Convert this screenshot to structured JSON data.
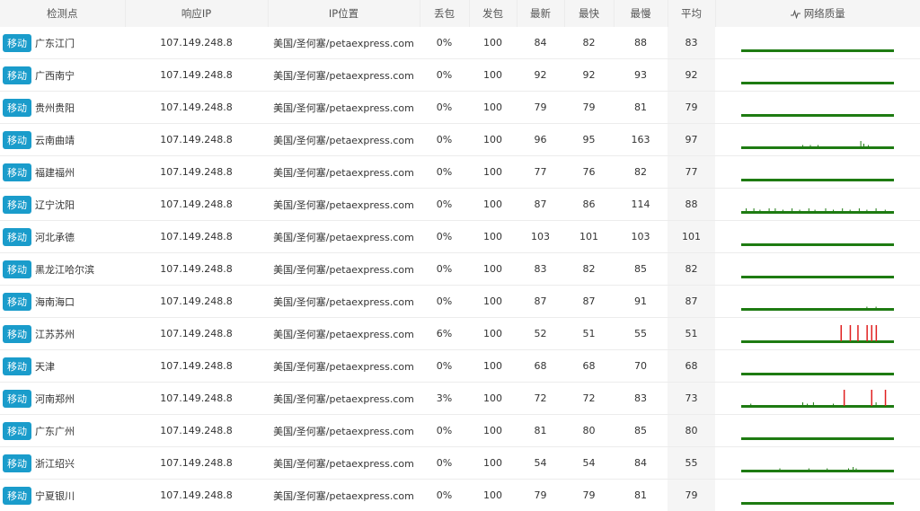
{
  "headers": {
    "node": "检测点",
    "ip": "响应IP",
    "location": "IP位置",
    "loss": "丢包",
    "sent": "发包",
    "latest": "最新",
    "fastest": "最快",
    "slowest": "最慢",
    "average": "平均",
    "quality": "网络质量"
  },
  "colors": {
    "good": "#1e7b12",
    "loss": "#e02020",
    "badge": "#1a9ccb"
  },
  "icons": {
    "quality": "pulse-icon"
  },
  "rows": [
    {
      "isp": "移动",
      "node": "广东江门",
      "ip": "107.149.248.8",
      "location": "美国/圣何塞/petaexpress.com",
      "loss": "0%",
      "sent": "100",
      "latest": "84",
      "fastest": "82",
      "slowest": "88",
      "average": "83",
      "quality": {
        "spikes": [],
        "lossMarks": []
      }
    },
    {
      "isp": "移动",
      "node": "广西南宁",
      "ip": "107.149.248.8",
      "location": "美国/圣何塞/petaexpress.com",
      "loss": "0%",
      "sent": "100",
      "latest": "92",
      "fastest": "92",
      "slowest": "93",
      "average": "92",
      "quality": {
        "spikes": [],
        "lossMarks": []
      }
    },
    {
      "isp": "移动",
      "node": "贵州贵阳",
      "ip": "107.149.248.8",
      "location": "美国/圣何塞/petaexpress.com",
      "loss": "0%",
      "sent": "100",
      "latest": "79",
      "fastest": "79",
      "slowest": "81",
      "average": "79",
      "quality": {
        "spikes": [],
        "lossMarks": []
      }
    },
    {
      "isp": "移动",
      "node": "云南曲靖",
      "ip": "107.149.248.8",
      "location": "美国/圣何塞/petaexpress.com",
      "loss": "0%",
      "sent": "100",
      "latest": "96",
      "fastest": "95",
      "slowest": "163",
      "average": "97",
      "quality": {
        "spikes": [
          [
            40,
            1
          ],
          [
            45,
            1
          ],
          [
            50,
            1
          ],
          [
            78,
            4
          ],
          [
            80,
            2
          ],
          [
            83,
            1
          ]
        ],
        "lossMarks": []
      }
    },
    {
      "isp": "移动",
      "node": "福建福州",
      "ip": "107.149.248.8",
      "location": "美国/圣何塞/petaexpress.com",
      "loss": "0%",
      "sent": "100",
      "latest": "77",
      "fastest": "76",
      "slowest": "82",
      "average": "77",
      "quality": {
        "spikes": [],
        "lossMarks": []
      }
    },
    {
      "isp": "移动",
      "node": "辽宁沈阳",
      "ip": "107.149.248.8",
      "location": "美国/圣何塞/petaexpress.com",
      "loss": "0%",
      "sent": "100",
      "latest": "87",
      "fastest": "86",
      "slowest": "114",
      "average": "88",
      "quality": {
        "spikes": [
          [
            3,
            2
          ],
          [
            8,
            2
          ],
          [
            12,
            1
          ],
          [
            18,
            2
          ],
          [
            22,
            2
          ],
          [
            27,
            1
          ],
          [
            33,
            2
          ],
          [
            38,
            1
          ],
          [
            44,
            2
          ],
          [
            48,
            1
          ],
          [
            55,
            2
          ],
          [
            60,
            1
          ],
          [
            66,
            2
          ],
          [
            71,
            1
          ],
          [
            77,
            2
          ],
          [
            82,
            1
          ],
          [
            88,
            2
          ],
          [
            94,
            1
          ]
        ],
        "lossMarks": []
      }
    },
    {
      "isp": "移动",
      "node": "河北承德",
      "ip": "107.149.248.8",
      "location": "美国/圣何塞/petaexpress.com",
      "loss": "0%",
      "sent": "100",
      "latest": "103",
      "fastest": "101",
      "slowest": "103",
      "average": "101",
      "quality": {
        "spikes": [],
        "lossMarks": []
      }
    },
    {
      "isp": "移动",
      "node": "黑龙江哈尔滨",
      "ip": "107.149.248.8",
      "location": "美国/圣何塞/petaexpress.com",
      "loss": "0%",
      "sent": "100",
      "latest": "83",
      "fastest": "82",
      "slowest": "85",
      "average": "82",
      "quality": {
        "spikes": [],
        "lossMarks": []
      }
    },
    {
      "isp": "移动",
      "node": "海南海口",
      "ip": "107.149.248.8",
      "location": "美国/圣何塞/petaexpress.com",
      "loss": "0%",
      "sent": "100",
      "latest": "87",
      "fastest": "87",
      "slowest": "91",
      "average": "87",
      "quality": {
        "spikes": [
          [
            82,
            1
          ],
          [
            88,
            1
          ]
        ],
        "lossMarks": []
      }
    },
    {
      "isp": "移动",
      "node": "江苏苏州",
      "ip": "107.149.248.8",
      "location": "美国/圣何塞/petaexpress.com",
      "loss": "6%",
      "sent": "100",
      "latest": "52",
      "fastest": "51",
      "slowest": "55",
      "average": "51",
      "quality": {
        "spikes": [],
        "lossMarks": [
          65,
          71,
          76,
          82,
          85,
          88
        ]
      }
    },
    {
      "isp": "移动",
      "node": "天津",
      "ip": "107.149.248.8",
      "location": "美国/圣何塞/petaexpress.com",
      "loss": "0%",
      "sent": "100",
      "latest": "68",
      "fastest": "68",
      "slowest": "70",
      "average": "68",
      "quality": {
        "spikes": [],
        "lossMarks": []
      }
    },
    {
      "isp": "移动",
      "node": "河南郑州",
      "ip": "107.149.248.8",
      "location": "美国/圣何塞/petaexpress.com",
      "loss": "3%",
      "sent": "100",
      "latest": "72",
      "fastest": "72",
      "slowest": "83",
      "average": "73",
      "quality": {
        "spikes": [
          [
            6,
            1
          ],
          [
            40,
            2
          ],
          [
            43,
            1
          ],
          [
            47,
            2
          ],
          [
            60,
            1
          ],
          [
            88,
            2
          ]
        ],
        "lossMarks": [
          67,
          85,
          94
        ]
      }
    },
    {
      "isp": "移动",
      "node": "广东广州",
      "ip": "107.149.248.8",
      "location": "美国/圣何塞/petaexpress.com",
      "loss": "0%",
      "sent": "100",
      "latest": "81",
      "fastest": "80",
      "slowest": "85",
      "average": "80",
      "quality": {
        "spikes": [],
        "lossMarks": []
      }
    },
    {
      "isp": "移动",
      "node": "浙江绍兴",
      "ip": "107.149.248.8",
      "location": "美国/圣何塞/petaexpress.com",
      "loss": "0%",
      "sent": "100",
      "latest": "54",
      "fastest": "54",
      "slowest": "84",
      "average": "55",
      "quality": {
        "spikes": [
          [
            25,
            1
          ],
          [
            44,
            1
          ],
          [
            56,
            1
          ],
          [
            70,
            1
          ],
          [
            75,
            1
          ],
          [
            73,
            2
          ]
        ],
        "lossMarks": []
      }
    },
    {
      "isp": "移动",
      "node": "宁夏银川",
      "ip": "107.149.248.8",
      "location": "美国/圣何塞/petaexpress.com",
      "loss": "0%",
      "sent": "100",
      "latest": "79",
      "fastest": "79",
      "slowest": "81",
      "average": "79",
      "quality": {
        "spikes": [],
        "lossMarks": []
      }
    }
  ]
}
